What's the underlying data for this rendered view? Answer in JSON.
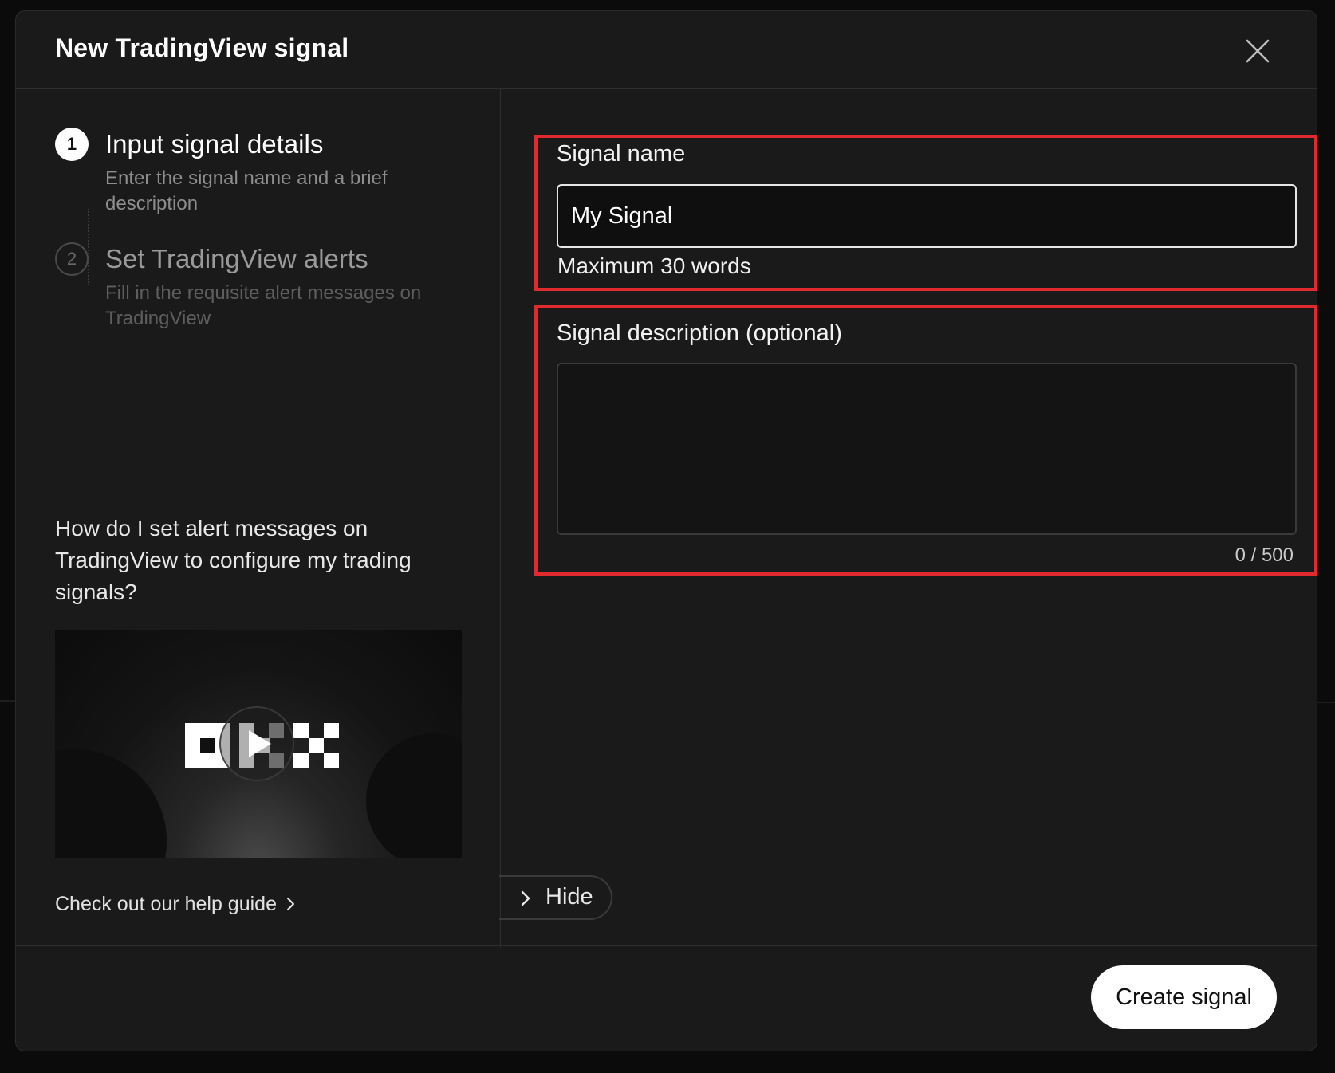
{
  "modal": {
    "title": "New TradingView signal"
  },
  "steps": [
    {
      "number": "1",
      "title": "Input signal details",
      "description": "Enter the signal name and a brief description",
      "state": "active"
    },
    {
      "number": "2",
      "title": "Set TradingView alerts",
      "description": "Fill in the requisite alert messages on TradingView",
      "state": "inactive"
    }
  ],
  "help": {
    "question": "How do I set alert messages on TradingView to configure my trading signals?",
    "video_logo": "OKX",
    "link_label": "Check out our help guide"
  },
  "form": {
    "signal_name": {
      "label": "Signal name",
      "value": "My Signal",
      "hint": "Maximum 30 words"
    },
    "signal_description": {
      "label": "Signal description (optional)",
      "value": "",
      "char_count": "0 / 500"
    }
  },
  "panel_toggle": {
    "label": "Hide"
  },
  "footer": {
    "create_label": "Create signal"
  },
  "colors": {
    "highlight_border": "#e02a2f",
    "modal_background": "#1a1a1a",
    "primary_button": "#ffffff"
  }
}
